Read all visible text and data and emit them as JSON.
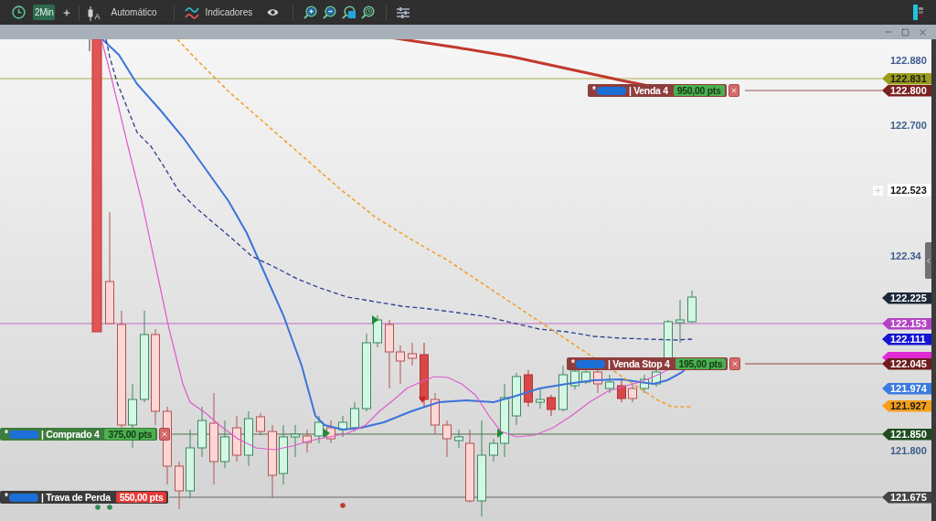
{
  "toolbar": {
    "timeframe": {
      "label": "2Min",
      "selected": true
    },
    "chart_type": {
      "subscript": "A"
    },
    "scale_mode": "Automático",
    "indicators": "Indicadores"
  },
  "price_axis": [
    {
      "kind": "tick",
      "text": "122.880"
    },
    {
      "kind": "tag",
      "text": "122.831",
      "color": "#9c9c1c"
    },
    {
      "kind": "tag",
      "text": "122.800",
      "color": "#7b2020"
    },
    {
      "kind": "tick",
      "text": "122.700"
    },
    {
      "kind": "cursor",
      "text": "122.523"
    },
    {
      "kind": "tick",
      "text": "122.34"
    },
    {
      "kind": "tag",
      "text": "122.225",
      "color": "#1c2838"
    },
    {
      "kind": "tag",
      "text": "122.153",
      "color": "#b444c4"
    },
    {
      "kind": "tag",
      "text": "122.111",
      "color": "#1414d4"
    },
    {
      "kind": "covered_tag",
      "color": "#e02ad4"
    },
    {
      "kind": "tag",
      "text": "122.045",
      "color": "#6e1c1c"
    },
    {
      "kind": "tag",
      "text": "121.974",
      "color": "#3b7be0"
    },
    {
      "kind": "tag",
      "text": "121.927",
      "color": "#f59e1b"
    },
    {
      "kind": "tag",
      "text": "121.850",
      "color": "#1f4d1f"
    },
    {
      "kind": "tick",
      "text": "121.800"
    },
    {
      "kind": "tag",
      "text": "121.675",
      "color": "#444444"
    }
  ],
  "orders": [
    {
      "kind": "sell",
      "marker": "*",
      "label": "| Venda 4",
      "badge": {
        "text": "950,00 pts",
        "kind": "profit"
      },
      "closable": true
    },
    {
      "kind": "sell_stop",
      "marker": "*",
      "label": "| Venda Stop 4",
      "badge": {
        "text": "195,00 pts",
        "kind": "profit"
      },
      "closable": true
    },
    {
      "kind": "buy",
      "marker": "*",
      "label": "| Comprado 4",
      "badge": {
        "text": "375,00 pts",
        "kind": "profit"
      },
      "closable": true
    },
    {
      "kind": "stop_loss",
      "marker": "*",
      "label": "| Trava de Perda",
      "badge": {
        "text": "550,00 pts",
        "kind": "loss"
      },
      "closable": false
    }
  ]
}
